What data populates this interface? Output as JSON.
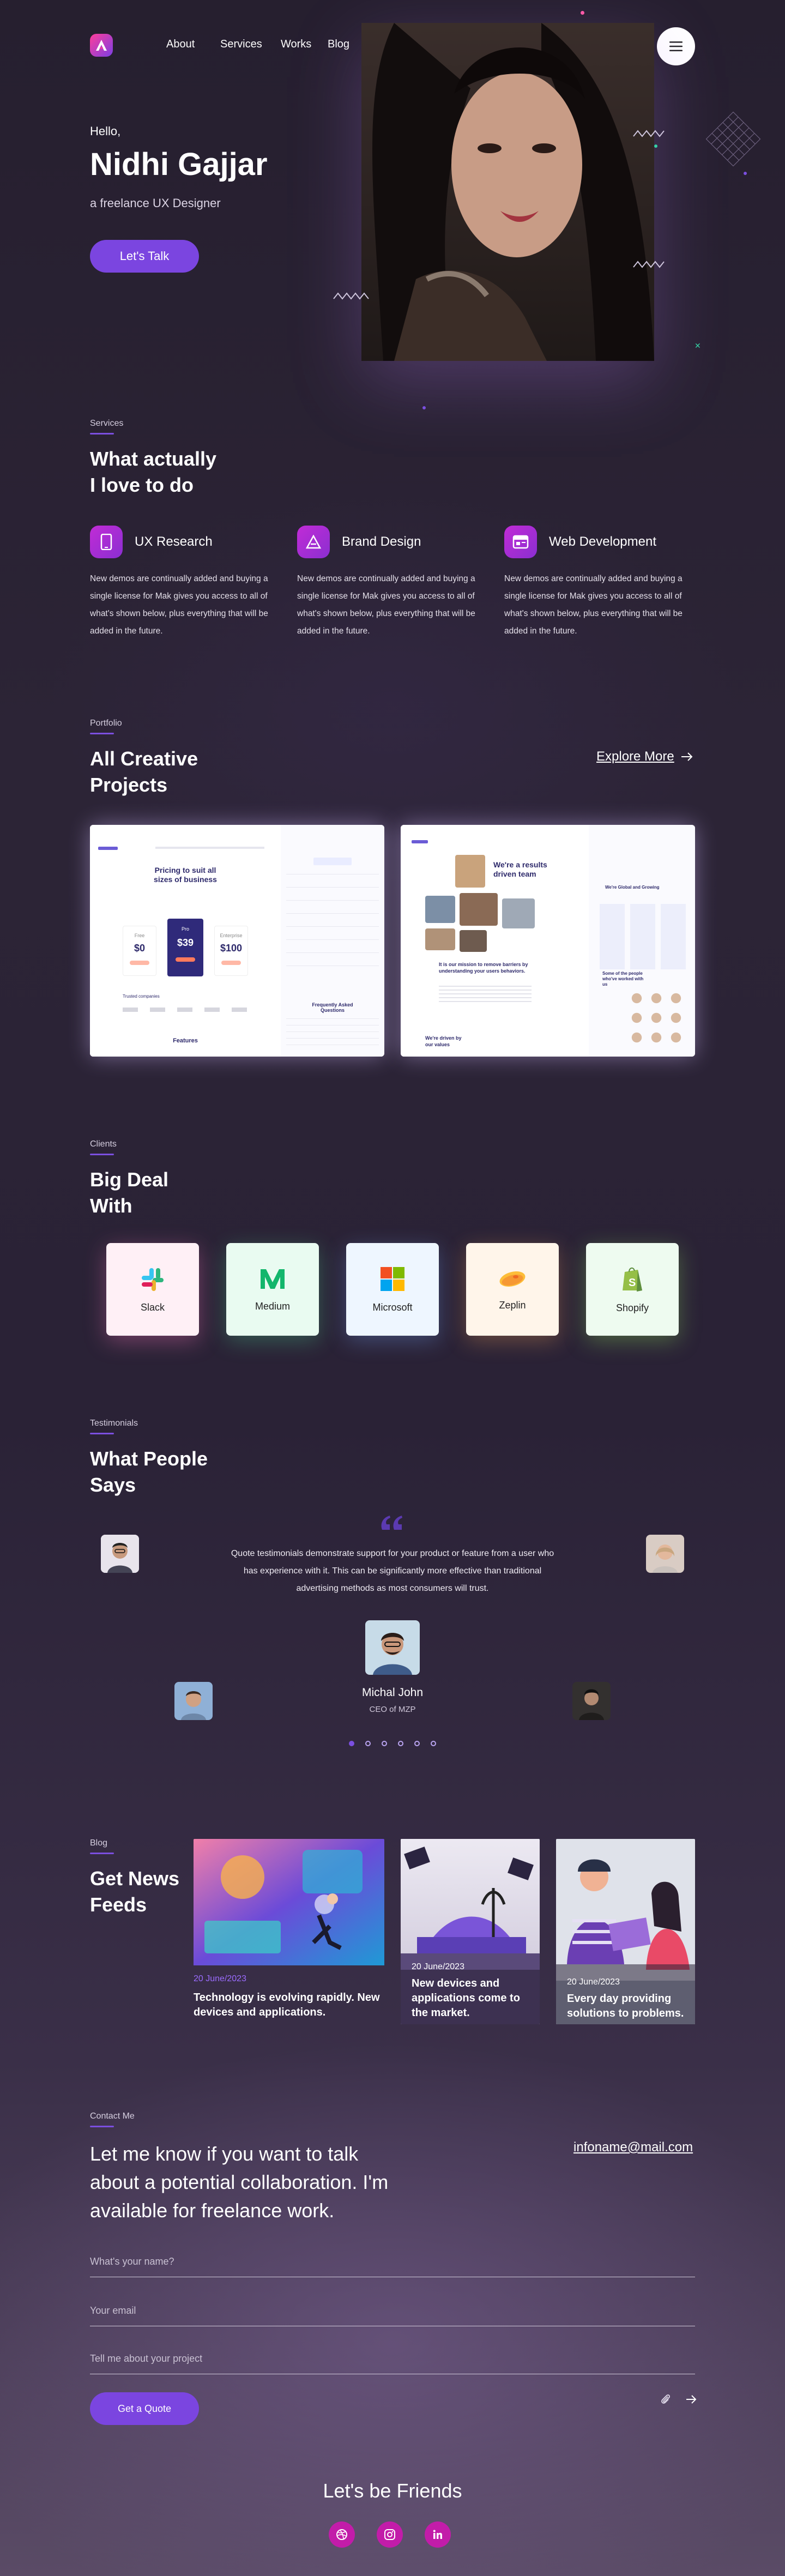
{
  "nav": {
    "items": [
      "About",
      "Services",
      "Works",
      "Blog"
    ],
    "logo_letter": "A",
    "menu_icon": "hamburger-icon"
  },
  "hero": {
    "greeting": "Hello,",
    "name": "Nidhi Gajjar",
    "subtitle": "a freelance UX Designer",
    "cta": "Let's Talk"
  },
  "services": {
    "eyebrow": "Services",
    "heading_line1": "What  actually",
    "heading_line2": "I love to do",
    "items": [
      {
        "title": "UX Research",
        "icon": "mobile-icon",
        "desc": "New demos are continually added and buying a single license for Mak gives you access to all of what's shown below, plus everything that will be added in the future."
      },
      {
        "title": "Brand Design",
        "icon": "triangle-logo-icon",
        "desc": "New demos are continually added and buying a single license for Mak gives you access to all of what's shown below, plus everything that will be added in the future."
      },
      {
        "title": "Web Development",
        "icon": "browser-window-icon",
        "desc": "New demos are continually added and buying a single license for Mak gives you access to all of what's shown below, plus everything that will be added in the future."
      }
    ]
  },
  "portfolio": {
    "eyebrow": "Portfolio",
    "heading_line1": "All Creative",
    "heading_line2": "Projects",
    "explore": "Explore More",
    "card1": {
      "headline": "Pricing to suit all sizes of business",
      "tiers": [
        "Free",
        "Pro",
        "Enterprise"
      ],
      "prices": [
        "$0",
        "$39",
        "$100"
      ],
      "trusted": "Trusted companies",
      "features": "Features",
      "faq": "Frequently Asked Questions"
    },
    "card2": {
      "headline": "We're a results driven team",
      "mission": "It is our mission to remove barriers by understanding your users behaviors.",
      "values": "We're driven by our values",
      "global": "We're Global and Growing",
      "people": "Some of the people who've worked with us"
    }
  },
  "clients": {
    "eyebrow": "Clients",
    "heading_line1": "Big Deal",
    "heading_line2": "With",
    "items": [
      {
        "name": "Slack",
        "bg": "#fff0f6"
      },
      {
        "name": "Medium",
        "bg": "#e9fbf1"
      },
      {
        "name": "Microsoft",
        "bg": "#eef6ff"
      },
      {
        "name": "Zeplin",
        "bg": "#fff5ea"
      },
      {
        "name": "Shopify",
        "bg": "#eefbf0"
      }
    ]
  },
  "testimonials": {
    "eyebrow": "Testimonials",
    "heading_line1": "What People",
    "heading_line2": "Says",
    "quote": "Quote testimonials demonstrate support for your product or feature from a user who has experience with it. This can be significantly more effective than traditional advertising methods as most consumers will trust.",
    "author": "Michal John",
    "role": "CEO of MZP",
    "slides": 6,
    "active_slide": 1
  },
  "blog": {
    "eyebrow": "Blog",
    "heading_line1": "Get News",
    "heading_line2": "Feeds",
    "posts": [
      {
        "date": "20 June/2023",
        "title": "Technology is evolving rapidly. New devices and applications."
      },
      {
        "date": "20 June/2023",
        "title": "New devices and applications come to the market."
      },
      {
        "date": "20 June/2023",
        "title": "Every day providing solutions to problems."
      }
    ]
  },
  "contact": {
    "eyebrow": "Contact Me",
    "question": "Let me know if you want to talk about a potential collaboration. I'm available for freelance work.",
    "email": "infoname@mail.com",
    "name_placeholder": "What's your name?",
    "email_placeholder": "Your email",
    "project_placeholder": "Tell me about your project",
    "submit": "Get a Quote"
  },
  "footer": {
    "title": "Let's be Friends",
    "socials": [
      "dribbble-icon",
      "instagram-icon",
      "linkedin-icon"
    ]
  },
  "colors": {
    "accent": "#7b45e0",
    "magenta": "#c21ca9",
    "background": "#2a2236"
  }
}
